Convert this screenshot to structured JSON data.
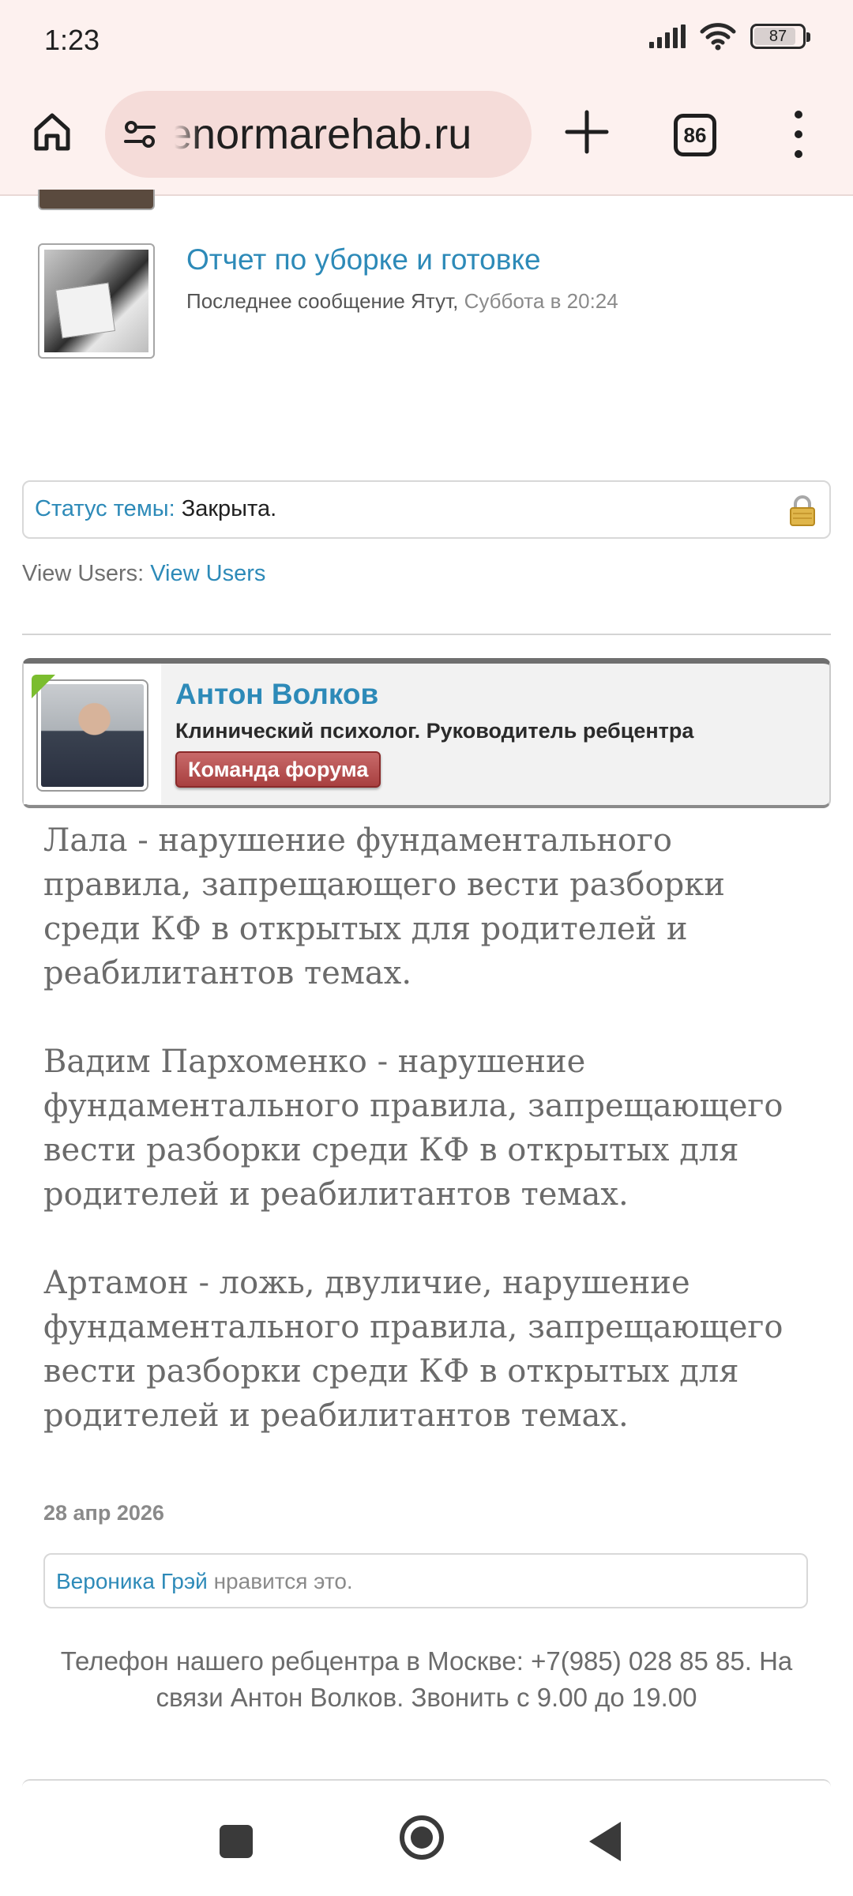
{
  "status_bar": {
    "time": "1:23",
    "battery": "87",
    "battery_level": 0.87,
    "icons": [
      "signal-icon",
      "wifi-icon",
      "battery-icon"
    ]
  },
  "browser": {
    "url": "enormarehab.ru",
    "tab_count": "86",
    "icons": [
      "home-icon",
      "site-settings-icon",
      "new-tab-icon",
      "tab-switcher-icon",
      "more-menu-icon"
    ]
  },
  "topic": {
    "title": "Отчет по уборке и готовке",
    "last_message_prefix": "Последнее сообщение Ятут,",
    "last_message_time": " Суббота в 20:24"
  },
  "thread_status": {
    "label": "Статус темы:",
    "value": " Закрыта."
  },
  "view_users": {
    "label": "View Users: ",
    "link": "View Users"
  },
  "post": {
    "author": "Антон Волков",
    "role": "Клинический психолог. Руководитель ребцентра",
    "rank": "Команда форума",
    "paragraphs": [
      "Лала - нарушение фундаментального правила, запрещающего вести разборки среди КФ в открытых для родителей и реабилитантов темах.",
      "Вадим Пархоменко - нарушение фундаментального правила, запрещающего вести разборки среди КФ в открытых для родителей и реабилитантов темах.",
      "Артамон - ложь, двуличие, нарушение фундаментального правила, запрещающего вести разборки среди КФ в открытых для родителей и реабилитантов темах."
    ],
    "date": "28 апр 2026",
    "likes_user": "Вероника Грэй",
    "likes_text": " нравится это.",
    "signature": "Телефон нашего ребцентра в Москве: +7(985) 028 85 85. На связи Антон Волков. Звонить с 9.00 до 19.00"
  },
  "colors": {
    "link": "#2d8ab8",
    "chrome_bg": "#fdf1ef",
    "urlbar_bg": "#f5dcd9",
    "rank_badge": "#a84040"
  }
}
